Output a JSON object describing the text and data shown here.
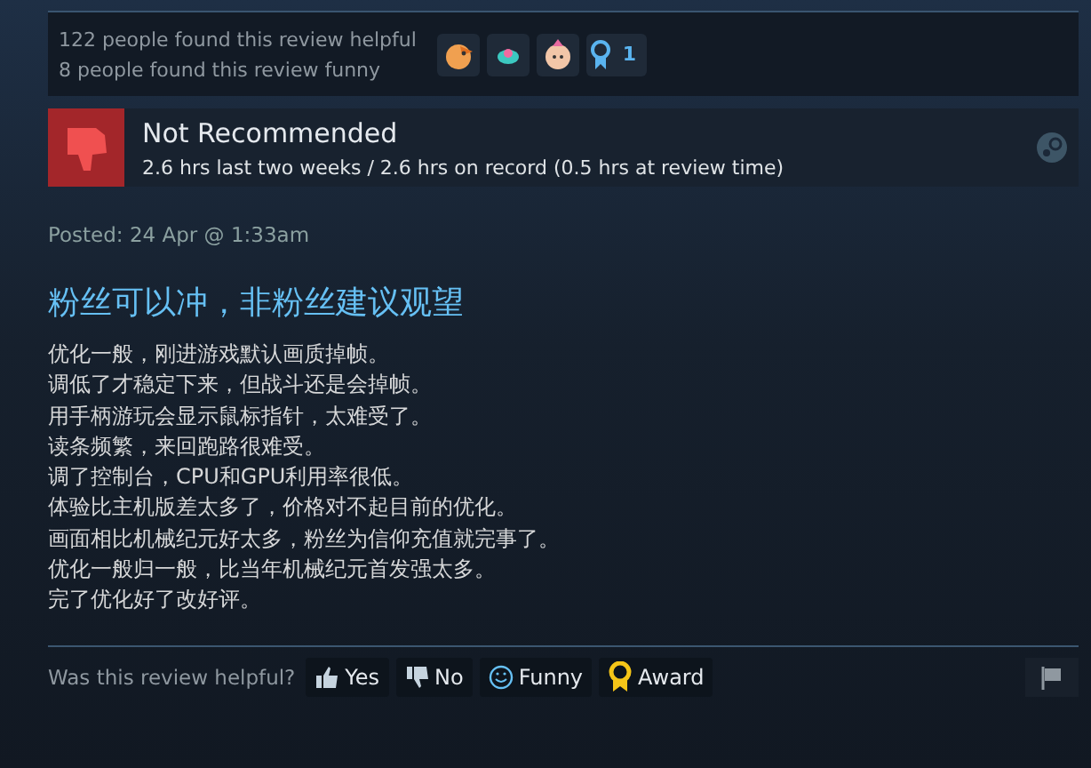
{
  "votes": {
    "helpful": "122 people found this review helpful",
    "funny": "8 people found this review funny"
  },
  "reactions": [
    {
      "kind": "face-orange"
    },
    {
      "kind": "blob-teal"
    },
    {
      "kind": "face-pink"
    },
    {
      "kind": "ribbon",
      "count": "1"
    }
  ],
  "recommendation": {
    "kind": "negative",
    "title": "Not Recommended",
    "hours": "2.6 hrs last two weeks / 2.6 hrs on record (0.5 hrs at review time)"
  },
  "posted": "Posted: 24 Apr @ 1:33am",
  "review_title": "粉丝可以冲，非粉丝建议观望",
  "lines": [
    "优化一般，刚进游戏默认画质掉帧。",
    "调低了才稳定下来，但战斗还是会掉帧。",
    "用手柄游玩会显示鼠标指针，太难受了。",
    "读条频繁，来回跑路很难受。",
    "调了控制台，CPU和GPU利用率很低。",
    "体验比主机版差太多了，价格对不起目前的优化。",
    "画面相比机械纪元好太多，粉丝为信仰充值就完事了。",
    "优化一般归一般，比当年机械纪元首发强太多。",
    "完了优化好了改好评。"
  ],
  "feedback": {
    "question": "Was this review helpful?",
    "buttons": [
      {
        "kind": "yes",
        "label": "Yes"
      },
      {
        "kind": "no",
        "label": "No"
      },
      {
        "kind": "funny",
        "label": "Funny"
      },
      {
        "kind": "award",
        "label": "Award"
      }
    ]
  }
}
